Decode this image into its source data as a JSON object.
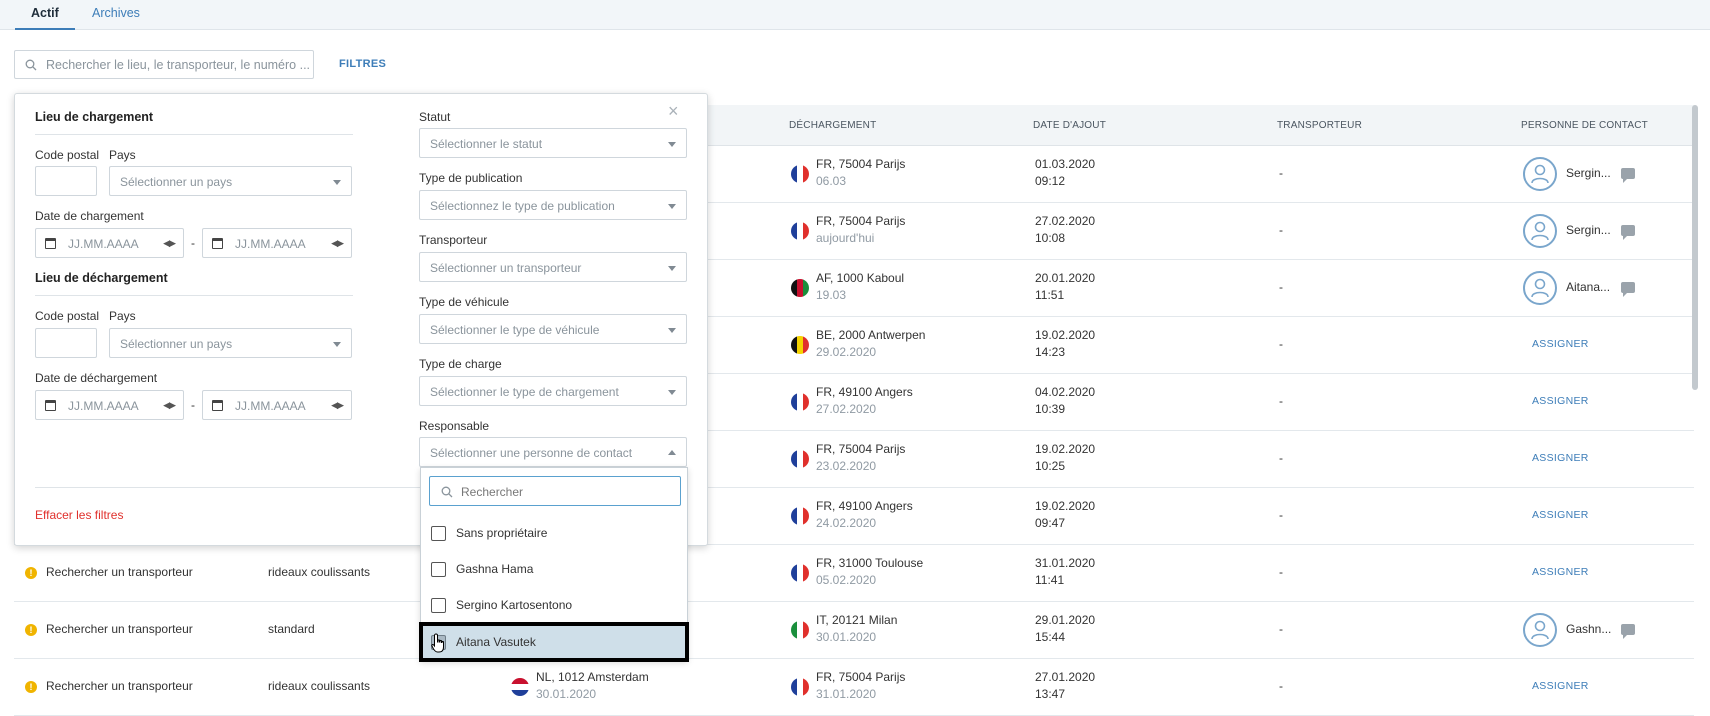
{
  "tabs": {
    "active": "Actif",
    "archives": "Archives"
  },
  "search": {
    "placeholder": "Rechercher le lieu, le transporteur, le numéro ..."
  },
  "filters_link": "FILTRES",
  "table": {
    "headers": {
      "dechargement": "DÉCHARGEMENT",
      "date_ajout": "DATE D'AJOUT",
      "transporteur": "TRANSPORTEUR",
      "contact": "PERSONNE DE CONTACT"
    },
    "rows": [
      {
        "unload_place": "FR, 75004 Parijs",
        "unload_date": "06.03",
        "unload_flag": "fr",
        "added_date": "01.03.2020",
        "added_time": "09:12",
        "carrier": "-",
        "contact": "Sergin...",
        "has_contact": true
      },
      {
        "unload_place": "FR, 75004 Parijs",
        "unload_date": "aujourd'hui",
        "unload_flag": "fr",
        "added_date": "27.02.2020",
        "added_time": "10:08",
        "carrier": "-",
        "contact": "Sergin...",
        "has_contact": true
      },
      {
        "unload_place": "AF, 1000 Kaboul",
        "unload_date": "19.03",
        "unload_flag": "af",
        "added_date": "20.01.2020",
        "added_time": "11:51",
        "carrier": "-",
        "contact": "Aitana...",
        "has_contact": true
      },
      {
        "unload_place": "BE, 2000 Antwerpen",
        "unload_date": "29.02.2020",
        "unload_flag": "be",
        "added_date": "19.02.2020",
        "added_time": "14:23",
        "carrier": "-",
        "contact": "ASSIGNER",
        "has_contact": false
      },
      {
        "unload_place": "FR, 49100 Angers",
        "unload_date": "27.02.2020",
        "unload_flag": "fr",
        "added_date": "04.02.2020",
        "added_time": "10:39",
        "carrier": "-",
        "contact": "ASSIGNER",
        "has_contact": false
      },
      {
        "unload_place": "FR, 75004 Parijs",
        "unload_date": "23.02.2020",
        "unload_flag": "fr",
        "added_date": "19.02.2020",
        "added_time": "10:25",
        "carrier": "-",
        "contact": "ASSIGNER",
        "has_contact": false
      },
      {
        "unload_place": "FR, 49100 Angers",
        "unload_date": "24.02.2020",
        "unload_flag": "fr",
        "added_date": "19.02.2020",
        "added_time": "09:47",
        "carrier": "-",
        "contact": "ASSIGNER",
        "has_contact": false
      },
      {
        "status": "Rechercher un transporteur",
        "vehicle": "rideaux coulissants",
        "unload_place": "FR, 31000 Toulouse",
        "unload_date": "05.02.2020",
        "unload_flag": "fr",
        "added_date": "31.01.2020",
        "added_time": "11:41",
        "carrier": "-",
        "contact": "ASSIGNER",
        "has_contact": false
      },
      {
        "status": "Rechercher un transporteur",
        "vehicle": "standard",
        "unload_place": "IT, 20121 Milan",
        "unload_date": "30.01.2020",
        "unload_flag": "it",
        "added_date": "29.01.2020",
        "added_time": "15:44",
        "carrier": "-",
        "contact": "Gashn...",
        "has_contact": true
      },
      {
        "status": "Rechercher un transporteur",
        "vehicle": "rideaux coulissants",
        "load_place": "NL, 1012 Amsterdam",
        "load_date": "30.01.2020",
        "load_flag": "nl",
        "unload_place": "FR, 75004 Parijs",
        "unload_date": "31.01.2020",
        "unload_flag": "fr",
        "added_date": "27.01.2020",
        "added_time": "13:47",
        "carrier": "-",
        "contact": "ASSIGNER",
        "has_contact": false
      }
    ]
  },
  "filter_panel": {
    "loading_title": "Lieu de chargement",
    "unloading_title": "Lieu de déchargement",
    "postal_code": "Code postal",
    "country": "Pays",
    "country_placeholder": "Sélectionner un pays",
    "loading_date": "Date de chargement",
    "unloading_date": "Date de déchargement",
    "date_placeholder": "JJ.MM.AAAA",
    "dash": "-",
    "statut_label": "Statut",
    "statut_ph": "Sélectionner le statut",
    "publication_label": "Type de publication",
    "publication_ph": "Sélectionnez le type de publication",
    "transporteur_label": "Transporteur",
    "transporteur_ph": "Sélectionner un transporteur",
    "vehicule_label": "Type de véhicule",
    "vehicule_ph": "Sélectionner le type de véhicule",
    "charge_label": "Type de charge",
    "charge_ph": "Sélectionner le type de chargement",
    "responsable_label": "Responsable",
    "responsable_ph": "Sélectionner une personne de contact",
    "clear": "Effacer les filtres",
    "close": "×"
  },
  "dropdown": {
    "search_placeholder": "Rechercher",
    "items": [
      "Sans propriétaire",
      "Gashna Hama",
      "Sergino Kartosentono",
      "Aitana Vasutek"
    ]
  },
  "colors": {
    "accent": "#3d7db8",
    "danger": "#e0302c",
    "warning": "#f0b400"
  }
}
